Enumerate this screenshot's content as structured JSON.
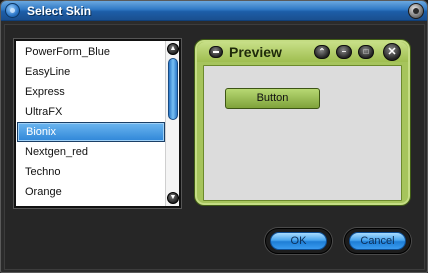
{
  "window": {
    "title": "Select Skin"
  },
  "skin_list": {
    "items": [
      {
        "label": "PowerForm_Blue"
      },
      {
        "label": "EasyLine"
      },
      {
        "label": "Express"
      },
      {
        "label": "UltraFX"
      },
      {
        "label": "Bionix"
      },
      {
        "label": "Nextgen_red"
      },
      {
        "label": "Techno"
      },
      {
        "label": "Orange"
      }
    ],
    "selected": "Bionix"
  },
  "preview": {
    "title": "Preview",
    "button_label": "Button"
  },
  "footer": {
    "ok_label": "OK",
    "cancel_label": "Cancel"
  },
  "colors": {
    "title_bar": "#2f78c4",
    "selection": "#2f86d8",
    "preview_frame": "#a6c45c",
    "dialog_button": "#4aa6ee"
  }
}
